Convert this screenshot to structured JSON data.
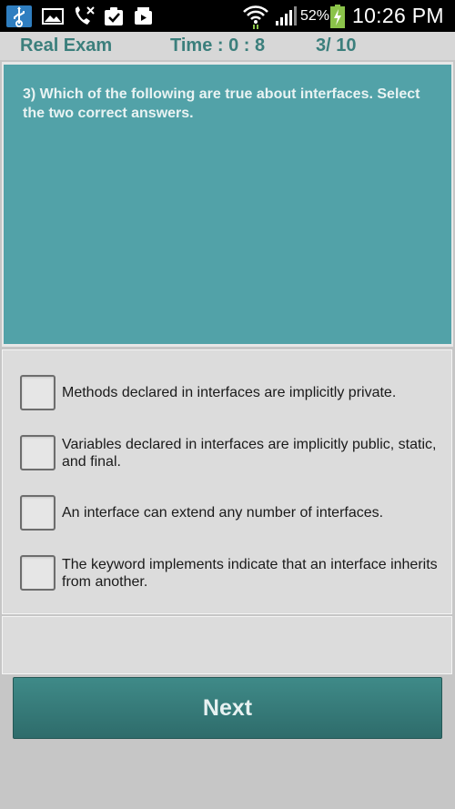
{
  "status_bar": {
    "icons": [
      "usb-icon",
      "gallery-icon",
      "missed-call-icon",
      "clipboard-check-icon",
      "video-share-icon",
      "wifi-icon",
      "signal-icon",
      "battery-charging-icon"
    ],
    "battery_percent": "52%",
    "time": "10:26 PM"
  },
  "header": {
    "mode": "Real Exam",
    "timer": "Time : 0 : 8",
    "progress": "3/ 10"
  },
  "question": {
    "text": "3) Which of the following are true about interfaces. Select the two correct answers."
  },
  "options": [
    {
      "text": "Methods declared in interfaces are implicitly private.",
      "checked": false
    },
    {
      "text": "Variables declared in interfaces are implicitly public, static, and final.",
      "checked": false
    },
    {
      "text": "An interface can extend any number of interfaces.",
      "checked": false
    },
    {
      "text": "The keyword implements indicate that an interface inherits from another.",
      "checked": false
    }
  ],
  "next_button": {
    "label": "Next"
  },
  "colors": {
    "accent": "#3b7f7c",
    "question_bg": "#52a2a8",
    "button_bg": "#35797a"
  }
}
